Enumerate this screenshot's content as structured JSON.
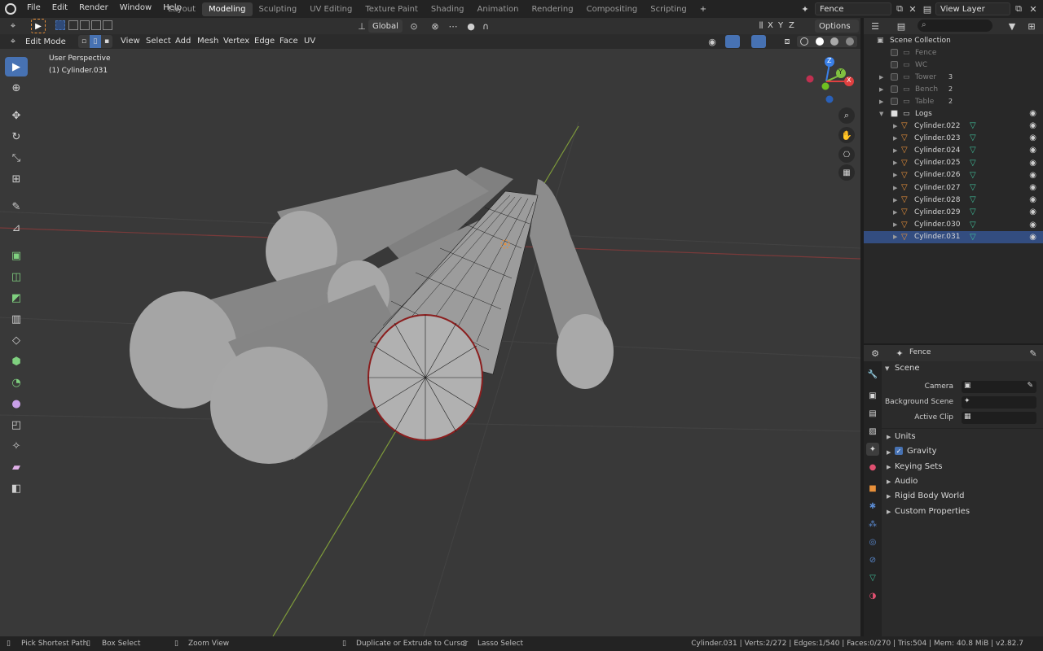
{
  "menubar": {
    "menus": [
      "File",
      "Edit",
      "Render",
      "Window",
      "Help"
    ],
    "workspaces": [
      "Layout",
      "Modeling",
      "Sculpting",
      "UV Editing",
      "Texture Paint",
      "Shading",
      "Animation",
      "Rendering",
      "Compositing",
      "Scripting"
    ],
    "active_workspace": "Modeling",
    "add_tab": "+",
    "scene_name": "Fence",
    "view_layer": "View Layer"
  },
  "viewport_header": {
    "transform_orientation": "Global",
    "axes": [
      "X",
      "Y",
      "Z"
    ],
    "options": "Options",
    "mode": "Edit Mode",
    "menus": [
      "View",
      "Select",
      "Add",
      "Mesh",
      "Vertex",
      "Edge",
      "Face",
      "UV"
    ]
  },
  "viewport": {
    "perspective": "User Perspective",
    "object": "(1) Cylinder.031",
    "gizmo_axes": [
      "Z",
      "Y",
      "X"
    ]
  },
  "outliner": {
    "root": "Scene Collection",
    "items": [
      {
        "name": "Fence",
        "checked": false,
        "dim": true
      },
      {
        "name": "WC",
        "checked": false,
        "dim": true
      },
      {
        "name": "Tower",
        "checked": false,
        "dim": true,
        "count": "3"
      },
      {
        "name": "Bench",
        "checked": false,
        "dim": true,
        "count": "2"
      },
      {
        "name": "Table",
        "checked": false,
        "dim": true,
        "count": "2"
      },
      {
        "name": "Logs",
        "checked": true,
        "dim": false
      }
    ],
    "objects": [
      "Cylinder.022",
      "Cylinder.023",
      "Cylinder.024",
      "Cylinder.025",
      "Cylinder.026",
      "Cylinder.027",
      "Cylinder.028",
      "Cylinder.029",
      "Cylinder.030",
      "Cylinder.031"
    ],
    "selected_object": "Cylinder.031"
  },
  "properties": {
    "header_name": "Fence",
    "section": "Scene",
    "fields": [
      {
        "label": "Camera"
      },
      {
        "label": "Background Scene"
      },
      {
        "label": "Active Clip"
      }
    ],
    "panels": [
      "Units",
      "Gravity",
      "Keying Sets",
      "Audio",
      "Rigid Body World",
      "Custom Properties"
    ],
    "gravity_checked": true
  },
  "statusbar": {
    "left": [
      "Pick Shortest Path",
      "Box Select",
      "Zoom View",
      "Duplicate or Extrude to Cursor",
      "Lasso Select"
    ],
    "right": "Cylinder.031 | Verts:2/272 | Edges:1/540 | Faces:0/270 | Tris:504 | Mem: 40.8 MiB | v2.82.7"
  },
  "colors": {
    "accent": "#4772b3",
    "selection": "#334d80",
    "object_icon": "#e8903a",
    "mesh_icon": "#3fbf9a",
    "axis_x": "#e04040",
    "axis_y": "#80c040",
    "axis_z": "#3a80e8"
  }
}
